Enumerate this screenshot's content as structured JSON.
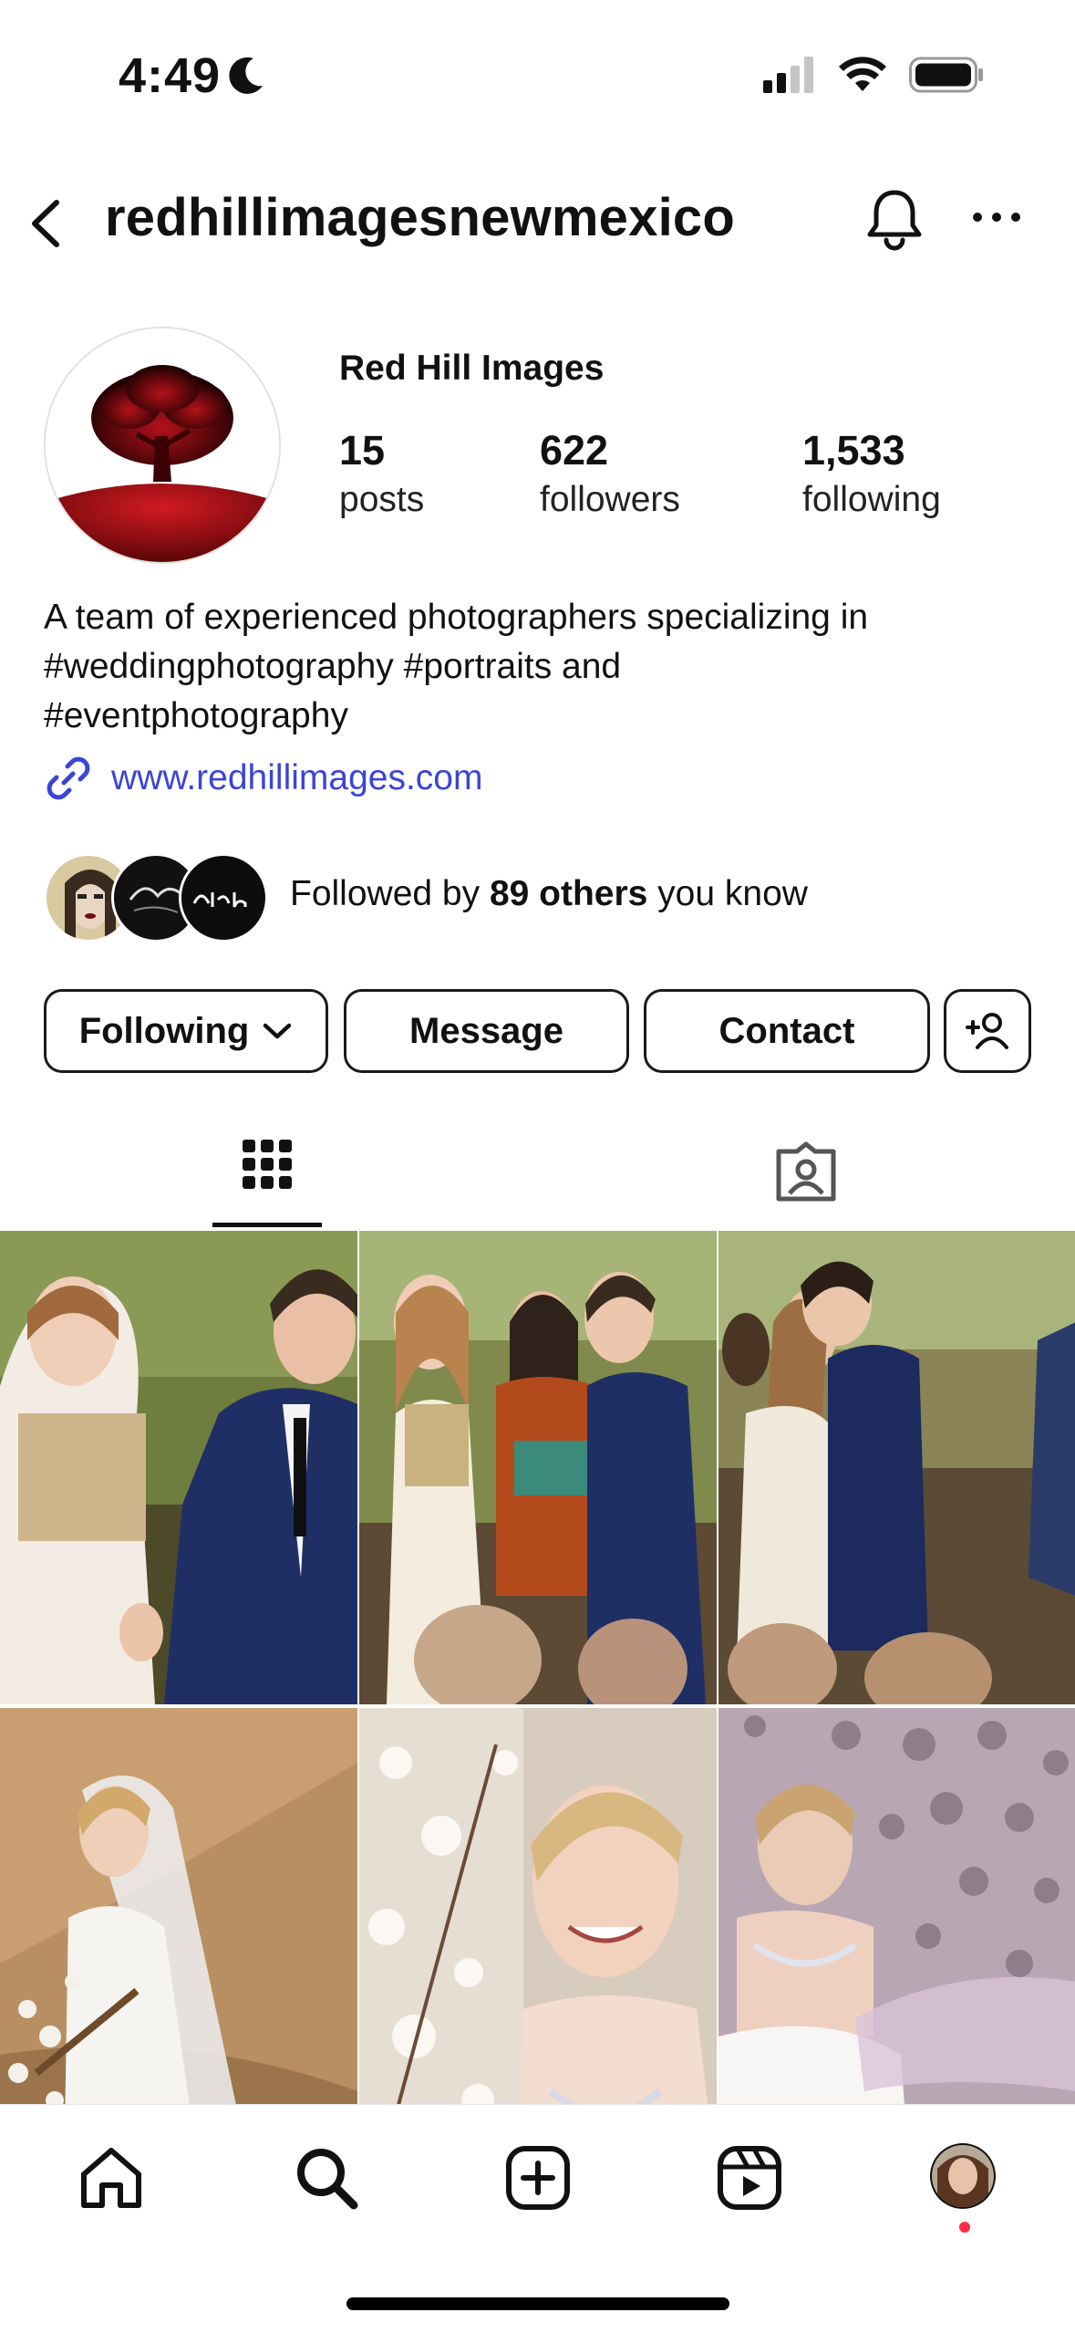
{
  "status_bar": {
    "time": "4:49"
  },
  "header": {
    "username": "redhillimagesnewmexico"
  },
  "profile": {
    "display_name": "Red Hill Images",
    "stats": [
      {
        "value": "15",
        "label": "posts"
      },
      {
        "value": "622",
        "label": "followers"
      },
      {
        "value": "1,533",
        "label": "following"
      }
    ],
    "bio_lines": [
      "A team of experienced photographers specializing in",
      "#weddingphotography #portraits and",
      "#eventphotography"
    ],
    "link": "www.redhillimages.com",
    "followed_by": {
      "prefix": "Followed by ",
      "bold": "89 others",
      "suffix": " you know"
    }
  },
  "actions": {
    "following_label": "Following",
    "message_label": "Message",
    "contact_label": "Contact"
  },
  "tabs": [
    {
      "name": "grid-icon",
      "active": true
    },
    {
      "name": "tagged-icon",
      "active": false
    }
  ],
  "grid_photos": [
    {
      "name": "couple-walking-photo"
    },
    {
      "name": "ceremony-handshake-photo"
    },
    {
      "name": "couple-kiss-photo"
    },
    {
      "name": "bride-staircase-photo"
    },
    {
      "name": "bride-blossoms-photo"
    },
    {
      "name": "bride-ballroom-photo"
    }
  ],
  "bottom_nav": [
    "home-icon",
    "search-icon",
    "create-icon",
    "reels-icon",
    "profile-avatar"
  ],
  "colors": {
    "link": "#3a45d6",
    "notification_dot": "#ff2d44",
    "logo_red": "#b3121b"
  }
}
